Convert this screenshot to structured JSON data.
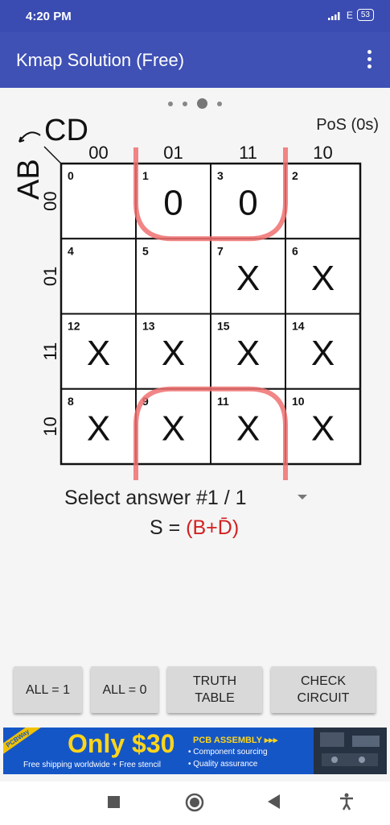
{
  "status_bar": {
    "time": "4:20 PM",
    "network": "E",
    "battery": "53"
  },
  "app_bar": {
    "title": "Kmap Solution (Free)"
  },
  "kmap": {
    "mode": "PoS (0s)",
    "row_var": "AB",
    "col_var": "CD",
    "col_headers": [
      "00",
      "01",
      "11",
      "10"
    ],
    "row_headers": [
      "00",
      "01",
      "11",
      "10"
    ],
    "cells": [
      [
        {
          "idx": "0",
          "val": ""
        },
        {
          "idx": "1",
          "val": "0"
        },
        {
          "idx": "3",
          "val": "0"
        },
        {
          "idx": "2",
          "val": ""
        }
      ],
      [
        {
          "idx": "4",
          "val": ""
        },
        {
          "idx": "5",
          "val": ""
        },
        {
          "idx": "7",
          "val": "X"
        },
        {
          "idx": "6",
          "val": "X"
        }
      ],
      [
        {
          "idx": "12",
          "val": "X"
        },
        {
          "idx": "13",
          "val": "X"
        },
        {
          "idx": "15",
          "val": "X"
        },
        {
          "idx": "14",
          "val": "X"
        }
      ],
      [
        {
          "idx": "8",
          "val": "X"
        },
        {
          "idx": "9",
          "val": "X"
        },
        {
          "idx": "11",
          "val": "X"
        },
        {
          "idx": "10",
          "val": "X"
        }
      ]
    ],
    "group_color": "#f07070"
  },
  "answer": {
    "select_label": "Select answer  #1 / 1",
    "solution_prefix": "S = ",
    "solution_expr": "(B+D̄)"
  },
  "buttons": {
    "all_one": "ALL = 1",
    "all_zero": "ALL = 0",
    "truth_table": [
      "TRUTH",
      "TABLE"
    ],
    "check_circuit": [
      "CHECK",
      "CIRCUIT"
    ]
  },
  "ad": {
    "ribbon": "PCBWay",
    "price": "Only $30",
    "tagline": "Free shipping worldwide  +  Free stencil",
    "headline": "PCB ASSEMBLY ▸▸▸",
    "bullets": [
      "• Component sourcing",
      "• Quality assurance"
    ]
  },
  "icons": {
    "menu": "more-vert-icon",
    "recents": "square-icon",
    "home": "circle-icon",
    "back": "triangle-back-icon",
    "accessibility": "accessibility-icon"
  }
}
